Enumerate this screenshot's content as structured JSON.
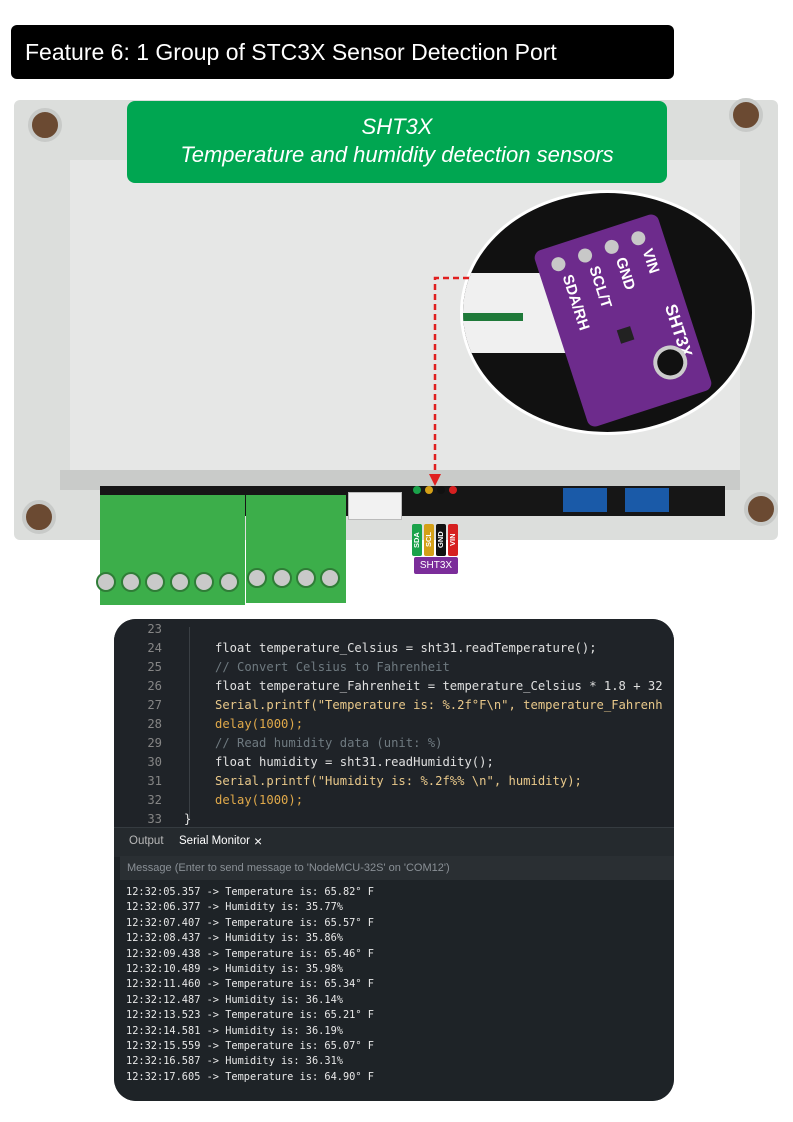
{
  "header": {
    "title": "Feature 6: 1 Group of STC3X Sensor Detection Port"
  },
  "banner": {
    "line1": "SHT3X",
    "line2": "Temperature and humidity detection sensors"
  },
  "sensor_board": {
    "pins": [
      "VIN",
      "GND",
      "SCL/T",
      "SDA/RH"
    ],
    "label": "SHT3X"
  },
  "pin_tags": [
    {
      "label": "SDA",
      "color": "#1aa24a"
    },
    {
      "label": "SCL",
      "color": "#d4a017"
    },
    {
      "label": "GND",
      "color": "#111111"
    },
    {
      "label": "VIN",
      "color": "#d62020"
    }
  ],
  "connector_label": "SHT3X",
  "code": {
    "lines": [
      {
        "num": "23",
        "text": ""
      },
      {
        "num": "24",
        "text": "float temperature_Celsius = sht31.readTemperature();"
      },
      {
        "num": "25",
        "text": "// Convert Celsius to Fahrenheit"
      },
      {
        "num": "26",
        "text": "float temperature_Fahrenheit = temperature_Celsius * 1.8 + 32"
      },
      {
        "num": "27",
        "text": "Serial.printf(\"Temperature is: %.2f°F\\n\", temperature_Fahrenh"
      },
      {
        "num": "28",
        "text": "delay(1000);"
      },
      {
        "num": "29",
        "text": "// Read humidity data (unit: %)"
      },
      {
        "num": "30",
        "text": "float humidity = sht31.readHumidity();"
      },
      {
        "num": "31",
        "text": "Serial.printf(\"Humidity is: %.2f%% \\n\", humidity);"
      },
      {
        "num": "32",
        "text": "delay(1000);"
      },
      {
        "num": "33",
        "text": "}"
      }
    ]
  },
  "panel": {
    "tab_output": "Output",
    "tab_serial": "Serial Monitor",
    "tab_close": "×",
    "message_placeholder": "Message (Enter to send message to 'NodeMCU-32S' on 'COM12')"
  },
  "serial_output": [
    "12:32:05.357 -> Temperature is: 65.82° F",
    "12:32:06.377 -> Humidity is: 35.77%",
    "12:32:07.407 -> Temperature is: 65.57° F",
    "12:32:08.437 -> Humidity is: 35.86%",
    "12:32:09.438 -> Temperature is: 65.46° F",
    "12:32:10.489 -> Humidity is: 35.98%",
    "12:32:11.460 -> Temperature is: 65.34° F",
    "12:32:12.487 -> Humidity is: 36.14%",
    "12:32:13.523 -> Temperature is: 65.21° F",
    "12:32:14.581 -> Humidity is: 36.19%",
    "12:32:15.559 -> Temperature is: 65.07° F",
    "12:32:16.587 -> Humidity is: 36.31%",
    "12:32:17.605 -> Temperature is: 64.90° F"
  ]
}
